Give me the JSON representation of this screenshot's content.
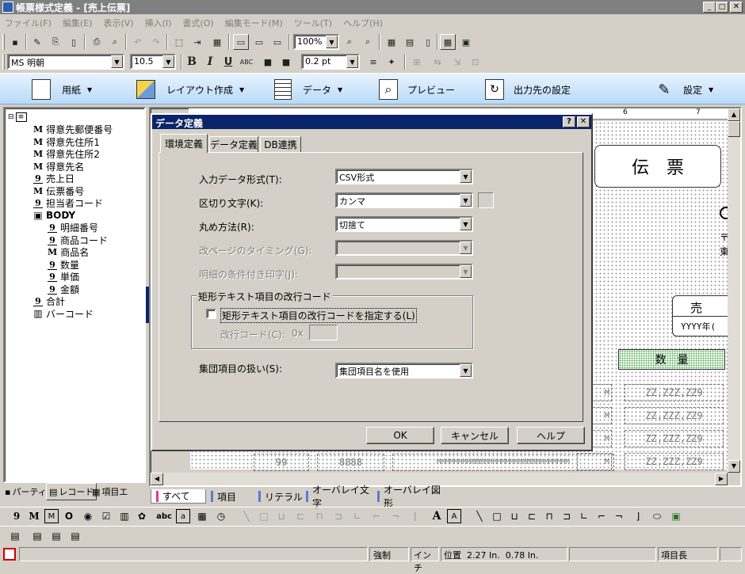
{
  "window": {
    "title": "帳票様式定義 - [売上伝票]"
  },
  "menu": [
    "ファイル(F)",
    "編集(E)",
    "表示(V)",
    "挿入(I)",
    "書式(O)",
    "編集モード(M)",
    "ツール(T)",
    "ヘルプ(H)"
  ],
  "toolbar": {
    "zoom": "100%",
    "font_name": "MS 明朝",
    "font_size": "10.5",
    "line_width": "0.2 pt"
  },
  "ribbon": [
    {
      "label": "用紙",
      "icon": "paper-icon",
      "dropdown": true
    },
    {
      "label": "レイアウト作成",
      "icon": "layout-icon",
      "dropdown": true
    },
    {
      "label": "データ",
      "icon": "data-table-icon",
      "dropdown": true
    },
    {
      "label": "プレビュー",
      "icon": "preview-icon",
      "dropdown": false
    },
    {
      "label": "出力先の設定",
      "icon": "output-icon",
      "dropdown": false
    },
    {
      "label": "設定",
      "icon": "settings-icon",
      "dropdown": true
    }
  ],
  "tree": [
    {
      "icon": "M",
      "label": "得意先郵便番号",
      "level": 1
    },
    {
      "icon": "M",
      "label": "得意先住所1",
      "level": 1
    },
    {
      "icon": "M",
      "label": "得意先住所2",
      "level": 1
    },
    {
      "icon": "M",
      "label": "得意先名",
      "level": 1
    },
    {
      "icon": "9",
      "label": "売上日",
      "level": 1
    },
    {
      "icon": "M",
      "label": "伝票番号",
      "level": 1
    },
    {
      "icon": "9",
      "label": "担当者コード",
      "level": 1
    },
    {
      "icon": "B",
      "label": "BODY",
      "level": 1
    },
    {
      "icon": "9",
      "label": "明細番号",
      "level": 2
    },
    {
      "icon": "9",
      "label": "商品コード",
      "level": 2
    },
    {
      "icon": "M",
      "label": "商品名",
      "level": 2
    },
    {
      "icon": "9",
      "label": "数量",
      "level": 2
    },
    {
      "icon": "9",
      "label": "単価",
      "level": 2
    },
    {
      "icon": "9",
      "label": "金額",
      "level": 2
    },
    {
      "icon": "9",
      "label": "合計",
      "level": 1
    },
    {
      "icon": "|||",
      "label": "バーコード",
      "level": 1
    }
  ],
  "left_tabs": [
    "パーティ",
    "レコード",
    "項目エ"
  ],
  "dialog": {
    "title": "データ定義",
    "tabs": [
      "環境定義",
      "データ定義",
      "DB連携"
    ],
    "fields": [
      {
        "label": "入力データ形式(T):",
        "value": "CSV形式",
        "enabled": true
      },
      {
        "label": "区切り文字(K):",
        "value": "カンマ",
        "enabled": true
      },
      {
        "label": "丸め方法(R):",
        "value": "切捨て",
        "enabled": true
      },
      {
        "label": "改ページのタイミング(G):",
        "value": "",
        "enabled": false
      },
      {
        "label": "明細の条件付き印字(J):",
        "value": "",
        "enabled": false
      }
    ],
    "group_title": "矩形テキスト項目の改行コード",
    "checkbox_label": "矩形テキスト項目の改行コードを指定する(L)",
    "newline_label": "改行コード(C):",
    "newline_prefix": "0x",
    "group_field_label": "集団項目の扱い(S):",
    "group_field_value": "集団項目名を使用",
    "ok": "OK",
    "cancel": "キャンセル",
    "help": "ヘルプ"
  },
  "canvas": {
    "title": "伝　票",
    "sales_label": "売",
    "date_text": "YYYY年(",
    "col_header": "数　量",
    "qty_cells": [
      "ZZ,ZZZ,ZZ9",
      "ZZ,ZZZ,ZZ9",
      "ZZ,ZZZ,ZZ9",
      "ZZ,ZZZ,ZZ9",
      "ZZ,ZZZ,ZZ9"
    ],
    "row_item": "99",
    "row_code": "8888",
    "row_name": "MMMMMMMMMMMMMMMMMMMMMMMMMMMMMMM",
    "left_cut": "M",
    "ruler_labels": [
      "6",
      "7"
    ],
    "partial_chars": [
      "〒",
      "東"
    ]
  },
  "sheet_tabs": [
    "すべて",
    "項目",
    "リテラル",
    "オーバレイ文字",
    "オーバレイ図形"
  ],
  "status": {
    "mode": "強制",
    "unit": "インチ",
    "position_label": "位置",
    "pos_x": "2.27 In.",
    "pos_y": "0.78 In.",
    "field": "項目長"
  }
}
